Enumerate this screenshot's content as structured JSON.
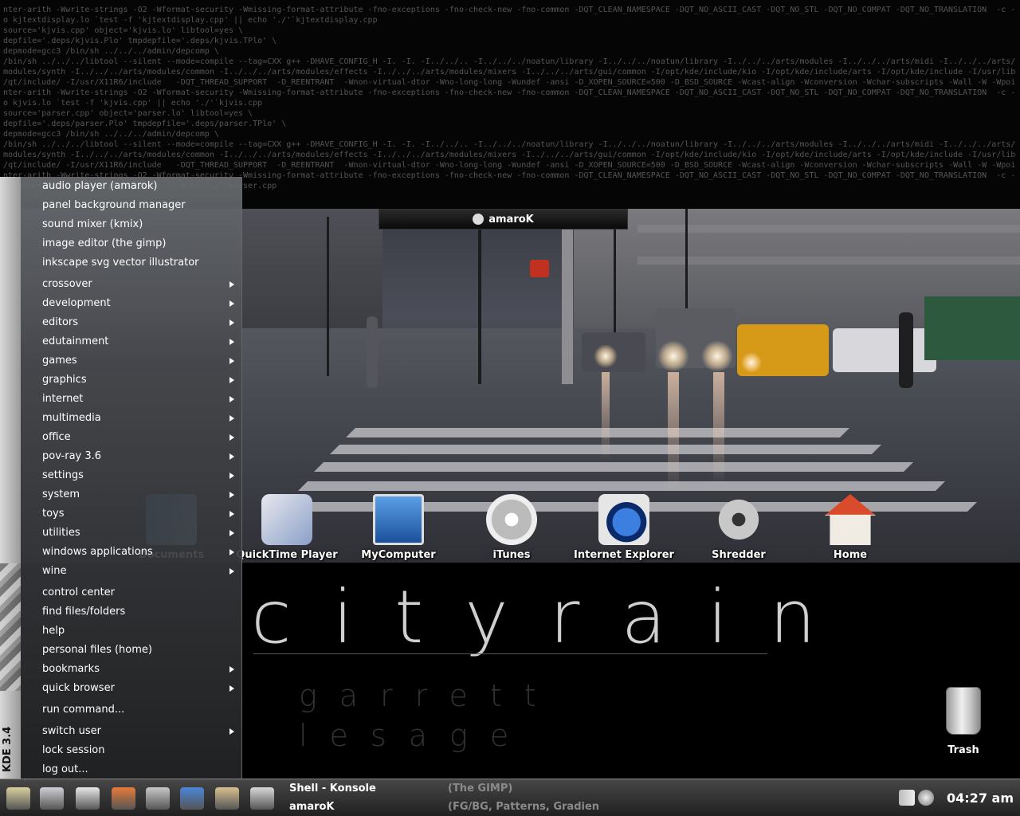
{
  "terminal": {
    "lines": [
      "nter-arith -Wwrite-strings -O2 -Wformat-security -Wmissing-format-attribute -fno-exceptions -fno-check-new -fno-common -DQT_CLEAN_NAMESPACE -DQT_NO_ASCII_CAST -DQT_NO_STL -DQT_NO_COMPAT -DQT_NO_TRANSLATION  -c -",
      "o kjtextdisplay.lo `test -f 'kjtextdisplay.cpp' || echo './'`kjtextdisplay.cpp",
      "source='kjvis.cpp' object='kjvis.lo' libtool=yes \\",
      "depfile='.deps/kjvis.Plo' tmpdepfile='.deps/kjvis.TPlo' \\",
      "depmode=gcc3 /bin/sh ../../../admin/depcomp \\",
      "/bin/sh ../../../libtool --silent --mode=compile --tag=CXX g++ -DHAVE_CONFIG_H -I. -I. -I../../.. -I../../../noatun/library -I../../../noatun/library -I../../../arts/modules -I../../../arts/midi -I../../../arts/",
      "modules/synth -I../../../arts/modules/common -I../../../arts/modules/effects -I../../../arts/modules/mixers -I../../../arts/gui/common -I/opt/kde/include/kio -I/opt/kde/include/arts -I/opt/kde/include -I/usr/lib",
      "/qt/include/ -I/usr/X11R6/include   -DQT_THREAD_SUPPORT  -D_REENTRANT  -Wnon-virtual-dtor -Wno-long-long -Wundef -ansi -D_XOPEN_SOURCE=500 -D_BSD_SOURCE -Wcast-align -Wconversion -Wchar-subscripts -Wall -W -Wpoi",
      "nter-arith -Wwrite-strings -O2 -Wformat-security -Wmissing-format-attribute -fno-exceptions -fno-check-new -fno-common -DQT_CLEAN_NAMESPACE -DQT_NO_ASCII_CAST -DQT_NO_STL -DQT_NO_COMPAT -DQT_NO_TRANSLATION  -c -",
      "o kjvis.lo `test -f 'kjvis.cpp' || echo './'`kjvis.cpp",
      "source='parser.cpp' object='parser.lo' libtool=yes \\",
      "depfile='.deps/parser.Plo' tmpdepfile='.deps/parser.TPlo' \\",
      "depmode=gcc3 /bin/sh ../../../admin/depcomp \\",
      "/bin/sh ../../../libtool --silent --mode=compile --tag=CXX g++ -DHAVE_CONFIG_H -I. -I. -I../../.. -I../../../noatun/library -I../../../noatun/library -I../../../arts/modules -I../../../arts/midi -I../../../arts/",
      "modules/synth -I../../../arts/modules/common -I../../../arts/modules/effects -I../../../arts/modules/mixers -I../../../arts/gui/common -I/opt/kde/include/kio -I/opt/kde/include/arts -I/opt/kde/include -I/usr/lib",
      "/qt/include/ -I/usr/X11R6/include   -DQT_THREAD_SUPPORT  -D_REENTRANT  -Wnon-virtual-dtor -Wno-long-long -Wundef -ansi -D_XOPEN_SOURCE=500 -D_BSD_SOURCE -Wcast-align -Wconversion -Wchar-subscripts -Wall -W -Wpoi",
      "nter-arith -Wwrite-strings -O2 -Wformat-security -Wmissing-format-attribute -fno-exceptions -fno-check-new -fno-common -DQT_CLEAN_NAMESPACE -DQT_NO_ASCII_CAST -DQT_NO_STL -DQT_NO_COMPAT -DQT_NO_TRANSLATION  -c -",
      "o parser.lo `test -f 'parser.cpp' || echo './'`parser.cpp"
    ]
  },
  "amarok_window": {
    "title": "amaroK"
  },
  "wallpaper": {
    "title": "cityrain",
    "subtitle": "garrett lesage"
  },
  "desktop_icons": [
    {
      "label": "Documents",
      "icon": "documents-folder-icon"
    },
    {
      "label": "QuickTime Player",
      "icon": "quicktime-icon"
    },
    {
      "label": "MyComputer",
      "icon": "computer-icon"
    },
    {
      "label": "iTunes",
      "icon": "itunes-icon"
    },
    {
      "label": "Internet Explorer",
      "icon": "internet-explorer-icon"
    },
    {
      "label": "Shredder",
      "icon": "shredder-icon"
    },
    {
      "label": "Home",
      "icon": "home-icon"
    }
  ],
  "trash": {
    "label": "Trash",
    "icon": "trash-icon"
  },
  "kmenu": {
    "version": "KDE 3.4",
    "items": [
      {
        "label": "audio player (amarok)",
        "submenu": false
      },
      {
        "label": "panel background manager",
        "submenu": false
      },
      {
        "label": "sound mixer (kmix)",
        "submenu": false
      },
      {
        "label": "image editor (the gimp)",
        "submenu": false
      },
      {
        "label": "inkscape svg vector illustrator",
        "submenu": false
      },
      {
        "label": "crossover",
        "submenu": true
      },
      {
        "label": "development",
        "submenu": true
      },
      {
        "label": "editors",
        "submenu": true
      },
      {
        "label": "edutainment",
        "submenu": true
      },
      {
        "label": "games",
        "submenu": true
      },
      {
        "label": "graphics",
        "submenu": true
      },
      {
        "label": "internet",
        "submenu": true
      },
      {
        "label": "multimedia",
        "submenu": true
      },
      {
        "label": "office",
        "submenu": true
      },
      {
        "label": "pov-ray 3.6",
        "submenu": true
      },
      {
        "label": "settings",
        "submenu": true
      },
      {
        "label": "system",
        "submenu": true
      },
      {
        "label": "toys",
        "submenu": true
      },
      {
        "label": "utilities",
        "submenu": true
      },
      {
        "label": "windows applications",
        "submenu": true
      },
      {
        "label": "wine",
        "submenu": true
      },
      {
        "label": "control center",
        "submenu": false
      },
      {
        "label": "find files/folders",
        "submenu": false
      },
      {
        "label": "help",
        "submenu": false
      },
      {
        "label": "personal files (home)",
        "submenu": false
      },
      {
        "label": "bookmarks",
        "submenu": true
      },
      {
        "label": "quick browser",
        "submenu": true
      },
      {
        "label": "run command...",
        "submenu": false
      },
      {
        "label": "switch user",
        "submenu": true
      },
      {
        "label": "lock session",
        "submenu": false
      },
      {
        "label": "log out...",
        "submenu": false
      }
    ]
  },
  "taskbar": {
    "launchers": [
      "kmenu-icon",
      "konqueror-icon",
      "terminal-window-icon",
      "home-folder-icon",
      "clock-icon",
      "browser-icon",
      "office-icon",
      "shell-icon"
    ],
    "tasks": [
      {
        "label": "Shell - Konsole",
        "active": true
      },
      {
        "label": "amaroK",
        "active": true
      },
      {
        "label": "(The GIMP)",
        "active": false
      },
      {
        "label": "(FG/BG, Patterns, Gradien",
        "active": false
      }
    ],
    "tray_icons": [
      "volume-icon",
      "network-icon"
    ],
    "clock": "04:27 am"
  }
}
